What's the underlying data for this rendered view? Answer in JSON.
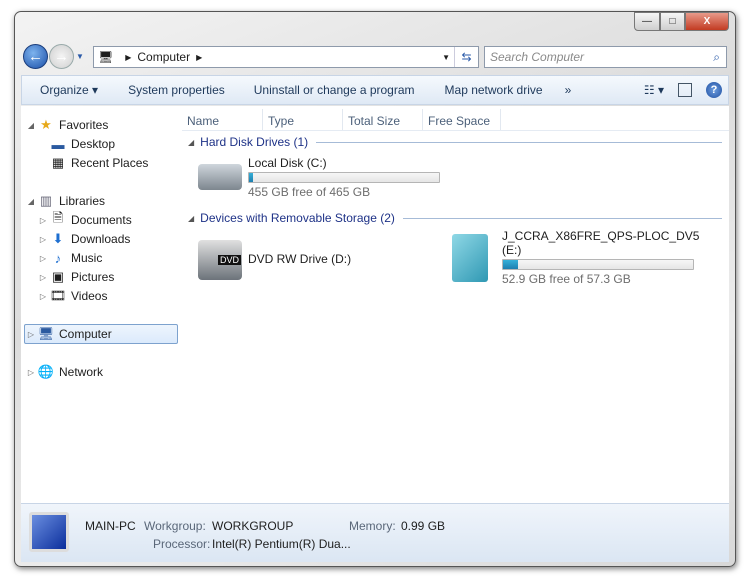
{
  "window": {
    "minimize": "—",
    "maximize": "□",
    "close": "X"
  },
  "address": {
    "crumbs": [
      "Computer"
    ],
    "search_placeholder": "Search Computer"
  },
  "toolbar": {
    "organize": "Organize",
    "system_properties": "System properties",
    "uninstall": "Uninstall or change a program",
    "map_drive": "Map network drive",
    "more": "»"
  },
  "nav": {
    "favorites": "Favorites",
    "desktop": "Desktop",
    "recent": "Recent Places",
    "libraries": "Libraries",
    "documents": "Documents",
    "downloads": "Downloads",
    "music": "Music",
    "pictures": "Pictures",
    "videos": "Videos",
    "computer": "Computer",
    "network": "Network"
  },
  "columns": [
    "Name",
    "Type",
    "Total Size",
    "Free Space"
  ],
  "groups": {
    "hdd": {
      "label": "Hard Disk Drives (1)",
      "drives": [
        {
          "name": "Local Disk (C:)",
          "free": "455 GB free of 465 GB",
          "used_fraction": 0.022
        }
      ]
    },
    "removable": {
      "label": "Devices with Removable Storage (2)",
      "dvd": {
        "name": "DVD RW Drive (D:)",
        "badge": "DVD"
      },
      "usb": {
        "name_line1": "J_CCRA_X86FRE_QPS-PLOC_DV5",
        "name_line2": "(E:)",
        "free": "52.9 GB free of 57.3 GB",
        "used_fraction": 0.077
      }
    }
  },
  "details": {
    "pc_name": "MAIN-PC",
    "workgroup_label": "Workgroup:",
    "workgroup": "WORKGROUP",
    "memory_label": "Memory:",
    "memory": "0.99 GB",
    "processor_label": "Processor:",
    "processor": "Intel(R) Pentium(R) Dua..."
  },
  "colors": {
    "accent": "#1e3287",
    "bar": "#2a95c5"
  }
}
